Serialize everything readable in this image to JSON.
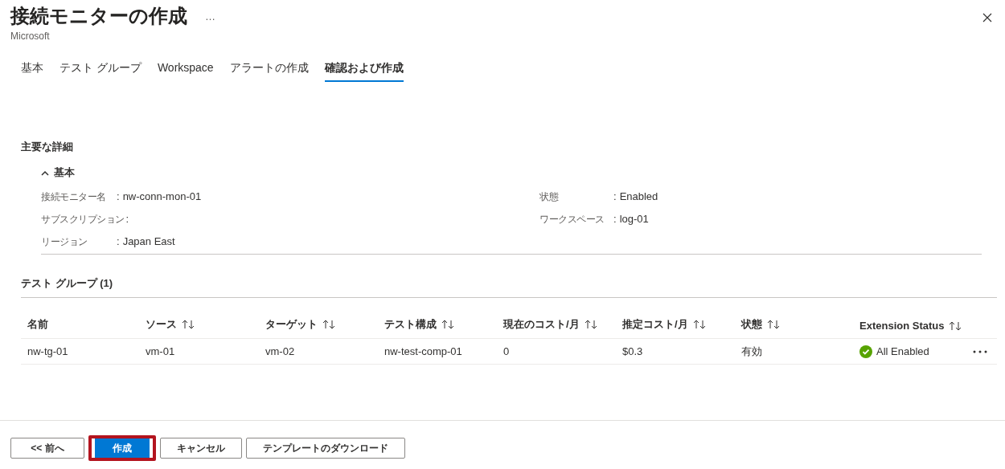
{
  "header": {
    "title": "接続モニターの作成",
    "more": "…",
    "subtitle": "Microsoft"
  },
  "tabs": [
    {
      "label": "基本",
      "selected": false
    },
    {
      "label": "テスト グループ",
      "selected": false
    },
    {
      "label": "Workspace",
      "selected": false
    },
    {
      "label": "アラートの作成",
      "selected": false
    },
    {
      "label": "確認および作成",
      "selected": true
    }
  ],
  "details": {
    "title": "主要な詳細",
    "section": {
      "label": "基本",
      "expanded": true,
      "left": [
        {
          "label": "接続モニター名",
          "separator": ":",
          "value": "nw-conn-mon-01"
        },
        {
          "label": "サブスクリプション",
          "separator": ":"
        },
        {
          "label": "リージョン",
          "separator": ":",
          "value": "Japan East"
        }
      ],
      "right": [
        {
          "label": "状態",
          "separator": ":",
          "value": "Enabled"
        },
        {
          "label": "ワークスペース",
          "separator": ":",
          "value": "log-01"
        }
      ]
    }
  },
  "test_groups": {
    "title": "テスト グループ (1)",
    "columns": [
      "名前",
      "ソース",
      "ターゲット",
      "テスト構成",
      "現在のコスト/月",
      "推定コスト/月",
      "状態",
      "Extension Status"
    ],
    "rows": [
      {
        "cells": [
          "nw-tg-01",
          "vm-01",
          "vm-02",
          "nw-test-comp-01",
          "0",
          "$0.3",
          "有効",
          "All Enabled"
        ]
      }
    ]
  },
  "buttons": [
    {
      "label": "<< 前へ",
      "kind": "secondary",
      "highlighted": false
    },
    {
      "label": "作成",
      "kind": "primary",
      "highlighted": true
    },
    {
      "label": "キャンセル",
      "kind": "secondary",
      "highlighted": false
    },
    {
      "label": "テンプレートのダウンロード",
      "kind": "secondary",
      "highlighted": false
    }
  ]
}
